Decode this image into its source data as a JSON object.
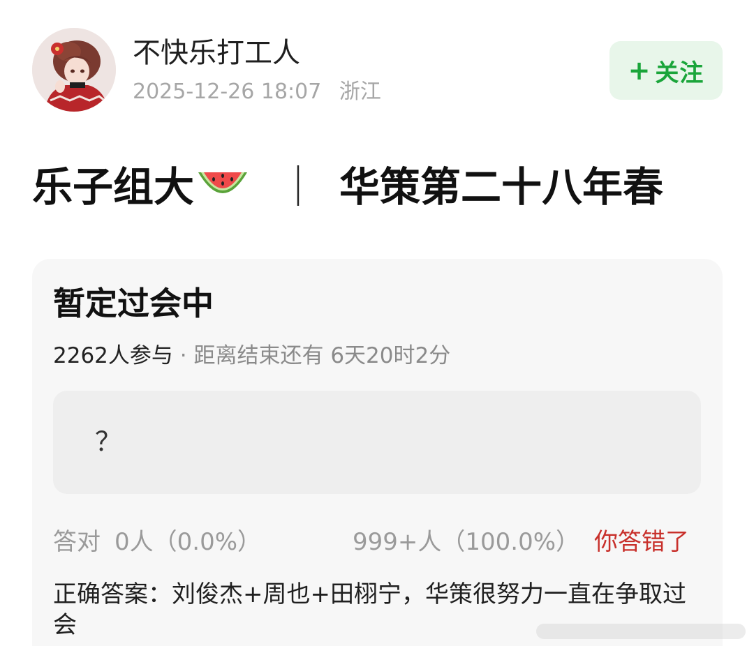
{
  "user": {
    "name": "不快乐打工人",
    "date": "2025-12-26 18:07",
    "location": "浙江",
    "follow_label": "关注"
  },
  "post": {
    "title_left": "乐子组大",
    "title_sep": "｜",
    "title_right": "华策第二十八年春"
  },
  "quiz": {
    "title": "暂定过会中",
    "participants": "2262人参与",
    "deadline": "· 距离结束还有 6天20时2分",
    "question_mark": "？",
    "correct_label": "答对",
    "correct_count": "0人（0.0%）",
    "wrong_count": "999+人（100.0%）",
    "wrong_flag": "你答错了",
    "answer_text": "正确答案：刘俊杰+周也+田栩宁，华策很努力一直在争取过会"
  },
  "colors": {
    "follow_bg": "#e8f6ea",
    "follow_text": "#1aa53a",
    "wrong_text": "#c8302b",
    "card_bg": "#f7f7f7"
  }
}
